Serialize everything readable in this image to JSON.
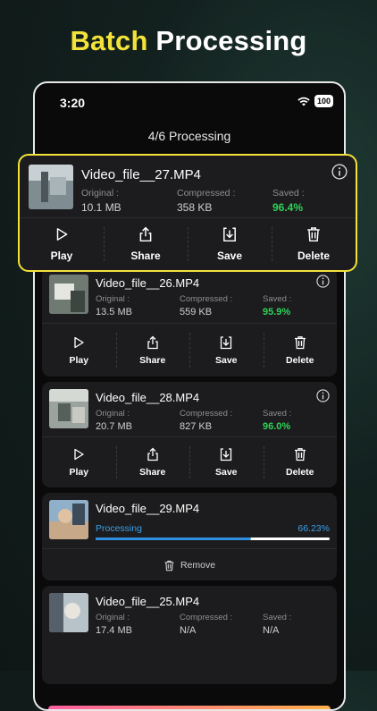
{
  "headline": {
    "part1": "Batch",
    "part2": "Processing"
  },
  "status": {
    "time": "3:20",
    "battery": "100"
  },
  "screen_title": "4/6 Processing",
  "labels": {
    "original": "Original :",
    "compressed": "Compressed :",
    "saved": "Saved :",
    "play": "Play",
    "share": "Share",
    "save": "Save",
    "delete": "Delete",
    "processing": "Processing",
    "remove": "Remove"
  },
  "highlight_card": {
    "file": "Video_file__27.MP4",
    "original": "10.1 MB",
    "compressed": "358 KB",
    "saved": "96.4%"
  },
  "cards": [
    {
      "file": "Video_file__26.MP4",
      "original": "13.5 MB",
      "compressed": "559 KB",
      "saved": "95.9%"
    },
    {
      "file": "Video_file__28.MP4",
      "original": "20.7 MB",
      "compressed": "827 KB",
      "saved": "96.0%"
    }
  ],
  "processing_card": {
    "file": "Video_file__29.MP4",
    "progress_text": "66.23%",
    "progress": 0.6623
  },
  "pending_card": {
    "file": "Video_file__25.MP4",
    "original": "17.4 MB",
    "compressed": "N/A",
    "saved": "N/A"
  },
  "colors": {
    "accent": "#f2e23a",
    "green": "#30d158",
    "progress": "#2f8fe0",
    "card": "#1c1c1e"
  }
}
